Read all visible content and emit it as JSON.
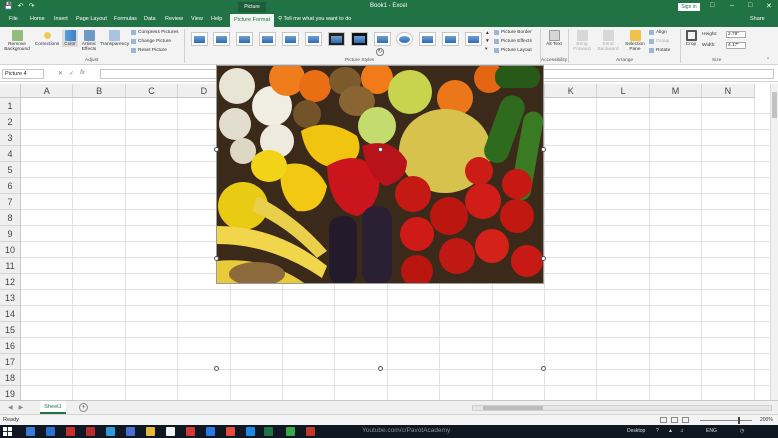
{
  "title_bar": {
    "context_label": "Picture Tools",
    "document_title": "Book1 - Excel",
    "signin_label": "Sign in"
  },
  "tabs": [
    "File",
    "Home",
    "Insert",
    "Page Layout",
    "Formulas",
    "Data",
    "Review",
    "View",
    "Help",
    "Picture Format"
  ],
  "active_tab": "Picture Format",
  "tell_me": "Tell me what you want to do",
  "share_label": "Share",
  "ribbon": {
    "remove_background": "Remove Background",
    "corrections": "Corrections",
    "color": "Color",
    "artistic_effects": "Artistic Effects",
    "transparency": "Transparency",
    "compress_pictures": "Compress Pictures",
    "change_picture": "Change Picture",
    "reset_picture": "Reset Picture",
    "adjust_group": "Adjust",
    "picture_styles_group": "Picture Styles",
    "picture_border": "Picture Border",
    "picture_effects": "Picture Effects",
    "picture_layout": "Picture Layout",
    "alt_text": "Alt Text",
    "accessibility_group": "Accessibility",
    "bring_forward": "Bring Forward",
    "send_backward": "Send Backward",
    "selection_pane": "Selection Pane",
    "align": "Align",
    "group": "Group",
    "rotate": "Rotate",
    "arrange_group": "Arrange",
    "crop": "Crop",
    "height_label": "Height:",
    "height_value": "2.78\"",
    "width_label": "Width:",
    "width_value": "4.17\"",
    "size_group": "Size"
  },
  "formula_bar": {
    "name_box": "Picture 4",
    "fx": "fx"
  },
  "columns": [
    "A",
    "B",
    "C",
    "D",
    "E",
    "F",
    "G",
    "H",
    "I",
    "J",
    "K",
    "L",
    "M",
    "N"
  ],
  "rows": [
    "1",
    "2",
    "3",
    "4",
    "5",
    "6",
    "7",
    "8",
    "9",
    "10",
    "11",
    "12",
    "13",
    "14",
    "15",
    "16",
    "17",
    "18",
    "19"
  ],
  "sheet_tab": "Sheet1",
  "status": {
    "ready": "Ready",
    "zoom": "200%"
  },
  "taskbar": {
    "watermark": "Youtube.com/c/PavotAcademy",
    "desktop": "Desktop",
    "lang": "ENG"
  }
}
